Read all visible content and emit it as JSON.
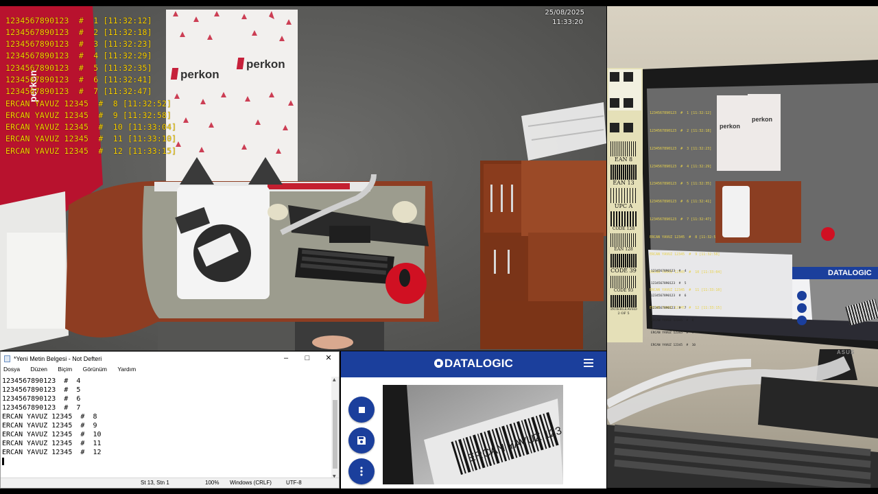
{
  "camera": {
    "date": "25/08/2025",
    "time": "11:33:20",
    "brand": "perkon",
    "device_label": "datalogic",
    "scan_log": [
      "1234567890123  #  1 [11:32:12]",
      "1234567890123  #  2 [11:32:18]",
      "1234567890123  #  3 [11:32:23]",
      "1234567890123  #  4 [11:32:29]",
      "1234567890123  #  5 [11:32:35]",
      "1234567890123  #  6 [11:32:41]",
      "1234567890123  #  7 [11:32:47]",
      "ERCAN YAVUZ 12345  #  8 [11:32:52]",
      "ERCAN YAVUZ 12345  #  9 [11:32:58]",
      "ERCAN YAVUZ 12345  #  10 [11:33:04]",
      "ERCAN YAVUZ 12345  #  11 [11:33:10]",
      "ERCAN YAVUZ 12345  #  12 [11:33:15]"
    ]
  },
  "notepad": {
    "title": "*Yeni Metin Belgesi - Not Defteri",
    "menu": [
      "Dosya",
      "Düzen",
      "Biçim",
      "Görünüm",
      "Yardım"
    ],
    "lines": [
      "1234567890123  #  4",
      "1234567890123  #  5",
      "1234567890123  #  6",
      "1234567890123  #  7",
      "ERCAN YAVUZ 12345  #  8",
      "ERCAN YAVUZ 12345  #  9",
      "ERCAN YAVUZ 12345  #  10",
      "ERCAN YAVUZ 12345  #  11",
      "ERCAN YAVUZ 12345  #  12"
    ],
    "status": {
      "position": "St 13, Stn 1",
      "zoom": "100%",
      "line_ending": "Windows (CRLF)",
      "encoding": "UTF-8"
    }
  },
  "datalogic_app": {
    "logo": "DATALOGIC",
    "preview_text": "ERCAN YAVUZ 123",
    "buttons": [
      "stop-icon",
      "save-icon",
      "more-vert-icon"
    ]
  },
  "photo": {
    "barcode_labels": [
      "EAN 8",
      "EAN 13",
      "UPC A",
      "CODE 128",
      "EAN 128",
      "CODE 39",
      "CODE 93",
      "INTERLEAVED 2 OF 5"
    ],
    "monitor_logo": "DATALOGIC",
    "monitor_brand": "ASUS"
  },
  "colors": {
    "overlay_text": "#ffd400",
    "datalogic_blue": "#1b3f9c",
    "perkon_red": "#c6203a"
  }
}
